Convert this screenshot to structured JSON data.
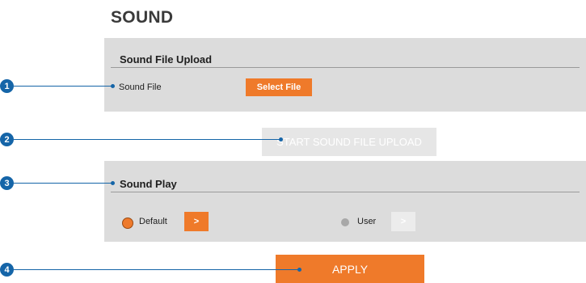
{
  "page": {
    "title": "SOUND"
  },
  "upload": {
    "title": "Sound File Upload",
    "file_label": "Sound File",
    "select_button": "Select File",
    "start_button": "START SOUND FILE UPLOAD"
  },
  "play": {
    "title": "Sound Play",
    "options": [
      {
        "label": "Default",
        "selected": true,
        "play_button": ">"
      },
      {
        "label": "User",
        "selected": false,
        "play_button": ">"
      }
    ]
  },
  "apply_button": "APPLY",
  "callouts": [
    "1",
    "2",
    "3",
    "4"
  ],
  "colors": {
    "accent": "#ef7a2a",
    "callout": "#1565a8",
    "panel": "#dcdcdc"
  }
}
